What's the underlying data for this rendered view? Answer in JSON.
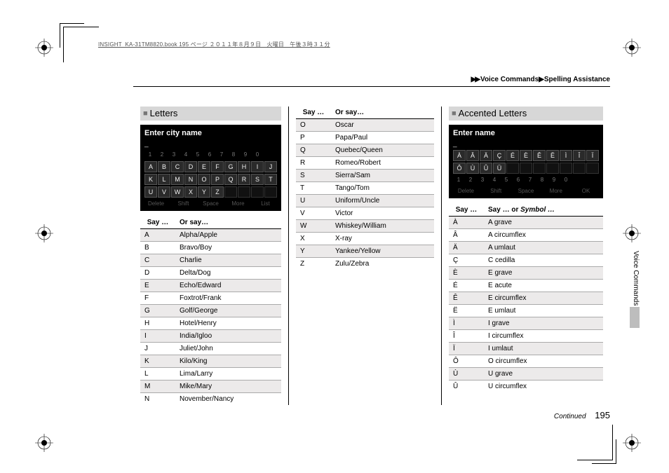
{
  "bookline": "INSIGHT_KA-31TM8820.book  195 ページ  ２０１１年８月９日　火曜日　午後３時３１分",
  "breadcrumb": {
    "arrows": "▶▶",
    "a": "Voice Commands",
    "b": "Spelling Assistance"
  },
  "page_number": "195",
  "continued": "Continued",
  "side_label": "Voice Commands",
  "letters": {
    "title": "Letters",
    "navi_title": "Enter city name",
    "nums": [
      "1",
      "2",
      "3",
      "4",
      "5",
      "6",
      "7",
      "8",
      "9",
      "0"
    ],
    "row1": [
      "A",
      "B",
      "C",
      "D",
      "E",
      "F",
      "G",
      "H",
      "I",
      "J"
    ],
    "row2": [
      "K",
      "L",
      "M",
      "N",
      "O",
      "P",
      "Q",
      "R",
      "S",
      "T"
    ],
    "row3": [
      "U",
      "V",
      "W",
      "X",
      "Y",
      "Z"
    ],
    "bottom": [
      "Delete",
      "Shift",
      "Space",
      "More",
      "List"
    ],
    "th_say": "Say …",
    "th_or": "Or say…",
    "th_or2": "Or say…",
    "rows1": [
      {
        "s": "A",
        "o": "Alpha/Apple"
      },
      {
        "s": "B",
        "o": "Bravo/Boy"
      },
      {
        "s": "C",
        "o": "Charlie"
      },
      {
        "s": "D",
        "o": "Delta/Dog"
      },
      {
        "s": "E",
        "o": "Echo/Edward"
      },
      {
        "s": "F",
        "o": "Foxtrot/Frank"
      },
      {
        "s": "G",
        "o": "Golf/George"
      },
      {
        "s": "H",
        "o": "Hotel/Henry"
      },
      {
        "s": "I",
        "o": "India/Igloo"
      },
      {
        "s": "J",
        "o": "Juliet/John"
      },
      {
        "s": "K",
        "o": "Kilo/King"
      },
      {
        "s": "L",
        "o": "Lima/Larry"
      },
      {
        "s": "M",
        "o": "Mike/Mary"
      },
      {
        "s": "N",
        "o": "November/Nancy"
      }
    ],
    "rows2": [
      {
        "s": "O",
        "o": "Oscar"
      },
      {
        "s": "P",
        "o": "Papa/Paul"
      },
      {
        "s": "Q",
        "o": "Quebec/Queen"
      },
      {
        "s": "R",
        "o": "Romeo/Robert"
      },
      {
        "s": "S",
        "o": "Sierra/Sam"
      },
      {
        "s": "T",
        "o": "Tango/Tom"
      },
      {
        "s": "U",
        "o": "Uniform/Uncle"
      },
      {
        "s": "V",
        "o": "Victor"
      },
      {
        "s": "W",
        "o": "Whiskey/William"
      },
      {
        "s": "X",
        "o": "X-ray"
      },
      {
        "s": "Y",
        "o": "Yankee/Yellow"
      },
      {
        "s": "Z",
        "o": "Zulu/Zebra"
      }
    ]
  },
  "accented": {
    "title": "Accented Letters",
    "navi_title": "Enter name",
    "row1": [
      "À",
      "Â",
      "Ä",
      "Ç",
      "É",
      "È",
      "Ê",
      "Ë",
      "Ì",
      "Î",
      "Ï"
    ],
    "row2": [
      "Ô",
      "Ù",
      "Û",
      "Ü"
    ],
    "bottom": [
      "Delete",
      "Shift",
      "Space",
      "More",
      "OK"
    ],
    "th_say": "Say …",
    "th_or_a": "Say … or",
    "th_or_b": "Symbol …",
    "rows": [
      {
        "s": "À",
        "o": "A grave"
      },
      {
        "s": "Â",
        "o": "A circumflex"
      },
      {
        "s": "Ä",
        "o": "A umlaut"
      },
      {
        "s": "Ç",
        "o": "C cedilla"
      },
      {
        "s": "È",
        "o": "E grave"
      },
      {
        "s": "É",
        "o": "E acute"
      },
      {
        "s": "Ê",
        "o": "E circumflex"
      },
      {
        "s": "Ë",
        "o": "E umlaut"
      },
      {
        "s": "Ì",
        "o": "I grave"
      },
      {
        "s": "Î",
        "o": "I circumflex"
      },
      {
        "s": "Ï",
        "o": "I umlaut"
      },
      {
        "s": "Ô",
        "o": "O circumflex"
      },
      {
        "s": "Ù",
        "o": "U grave"
      },
      {
        "s": "Û",
        "o": "U circumflex"
      }
    ]
  }
}
